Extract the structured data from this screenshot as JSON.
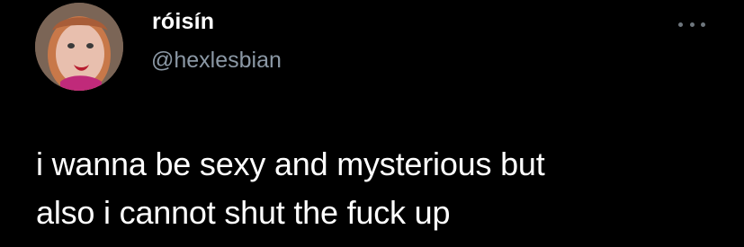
{
  "tweet": {
    "author": {
      "display_name": "róisín",
      "handle": "@hexlesbian",
      "avatar_icon": "profile-photo"
    },
    "more_icon": "more-options-icon",
    "text_lines": [
      "i wanna be sexy and mysterious but",
      "also i cannot shut the fuck up"
    ]
  },
  "colors": {
    "background": "#000000",
    "primary_text": "#ffffff",
    "secondary_text": "#8b98a5",
    "icon": "#6e767d"
  }
}
